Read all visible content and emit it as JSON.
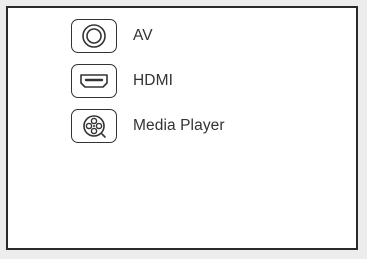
{
  "sources": {
    "items": [
      {
        "label": "AV",
        "icon": "av-jack-icon"
      },
      {
        "label": "HDMI",
        "icon": "hdmi-port-icon"
      },
      {
        "label": "Media Player",
        "icon": "media-player-icon"
      }
    ]
  },
  "colors": {
    "frame_border": "#2a2a2a",
    "icon_stroke": "#333333",
    "text": "#333333",
    "background": "#ffffff",
    "page_background": "#ededed"
  }
}
